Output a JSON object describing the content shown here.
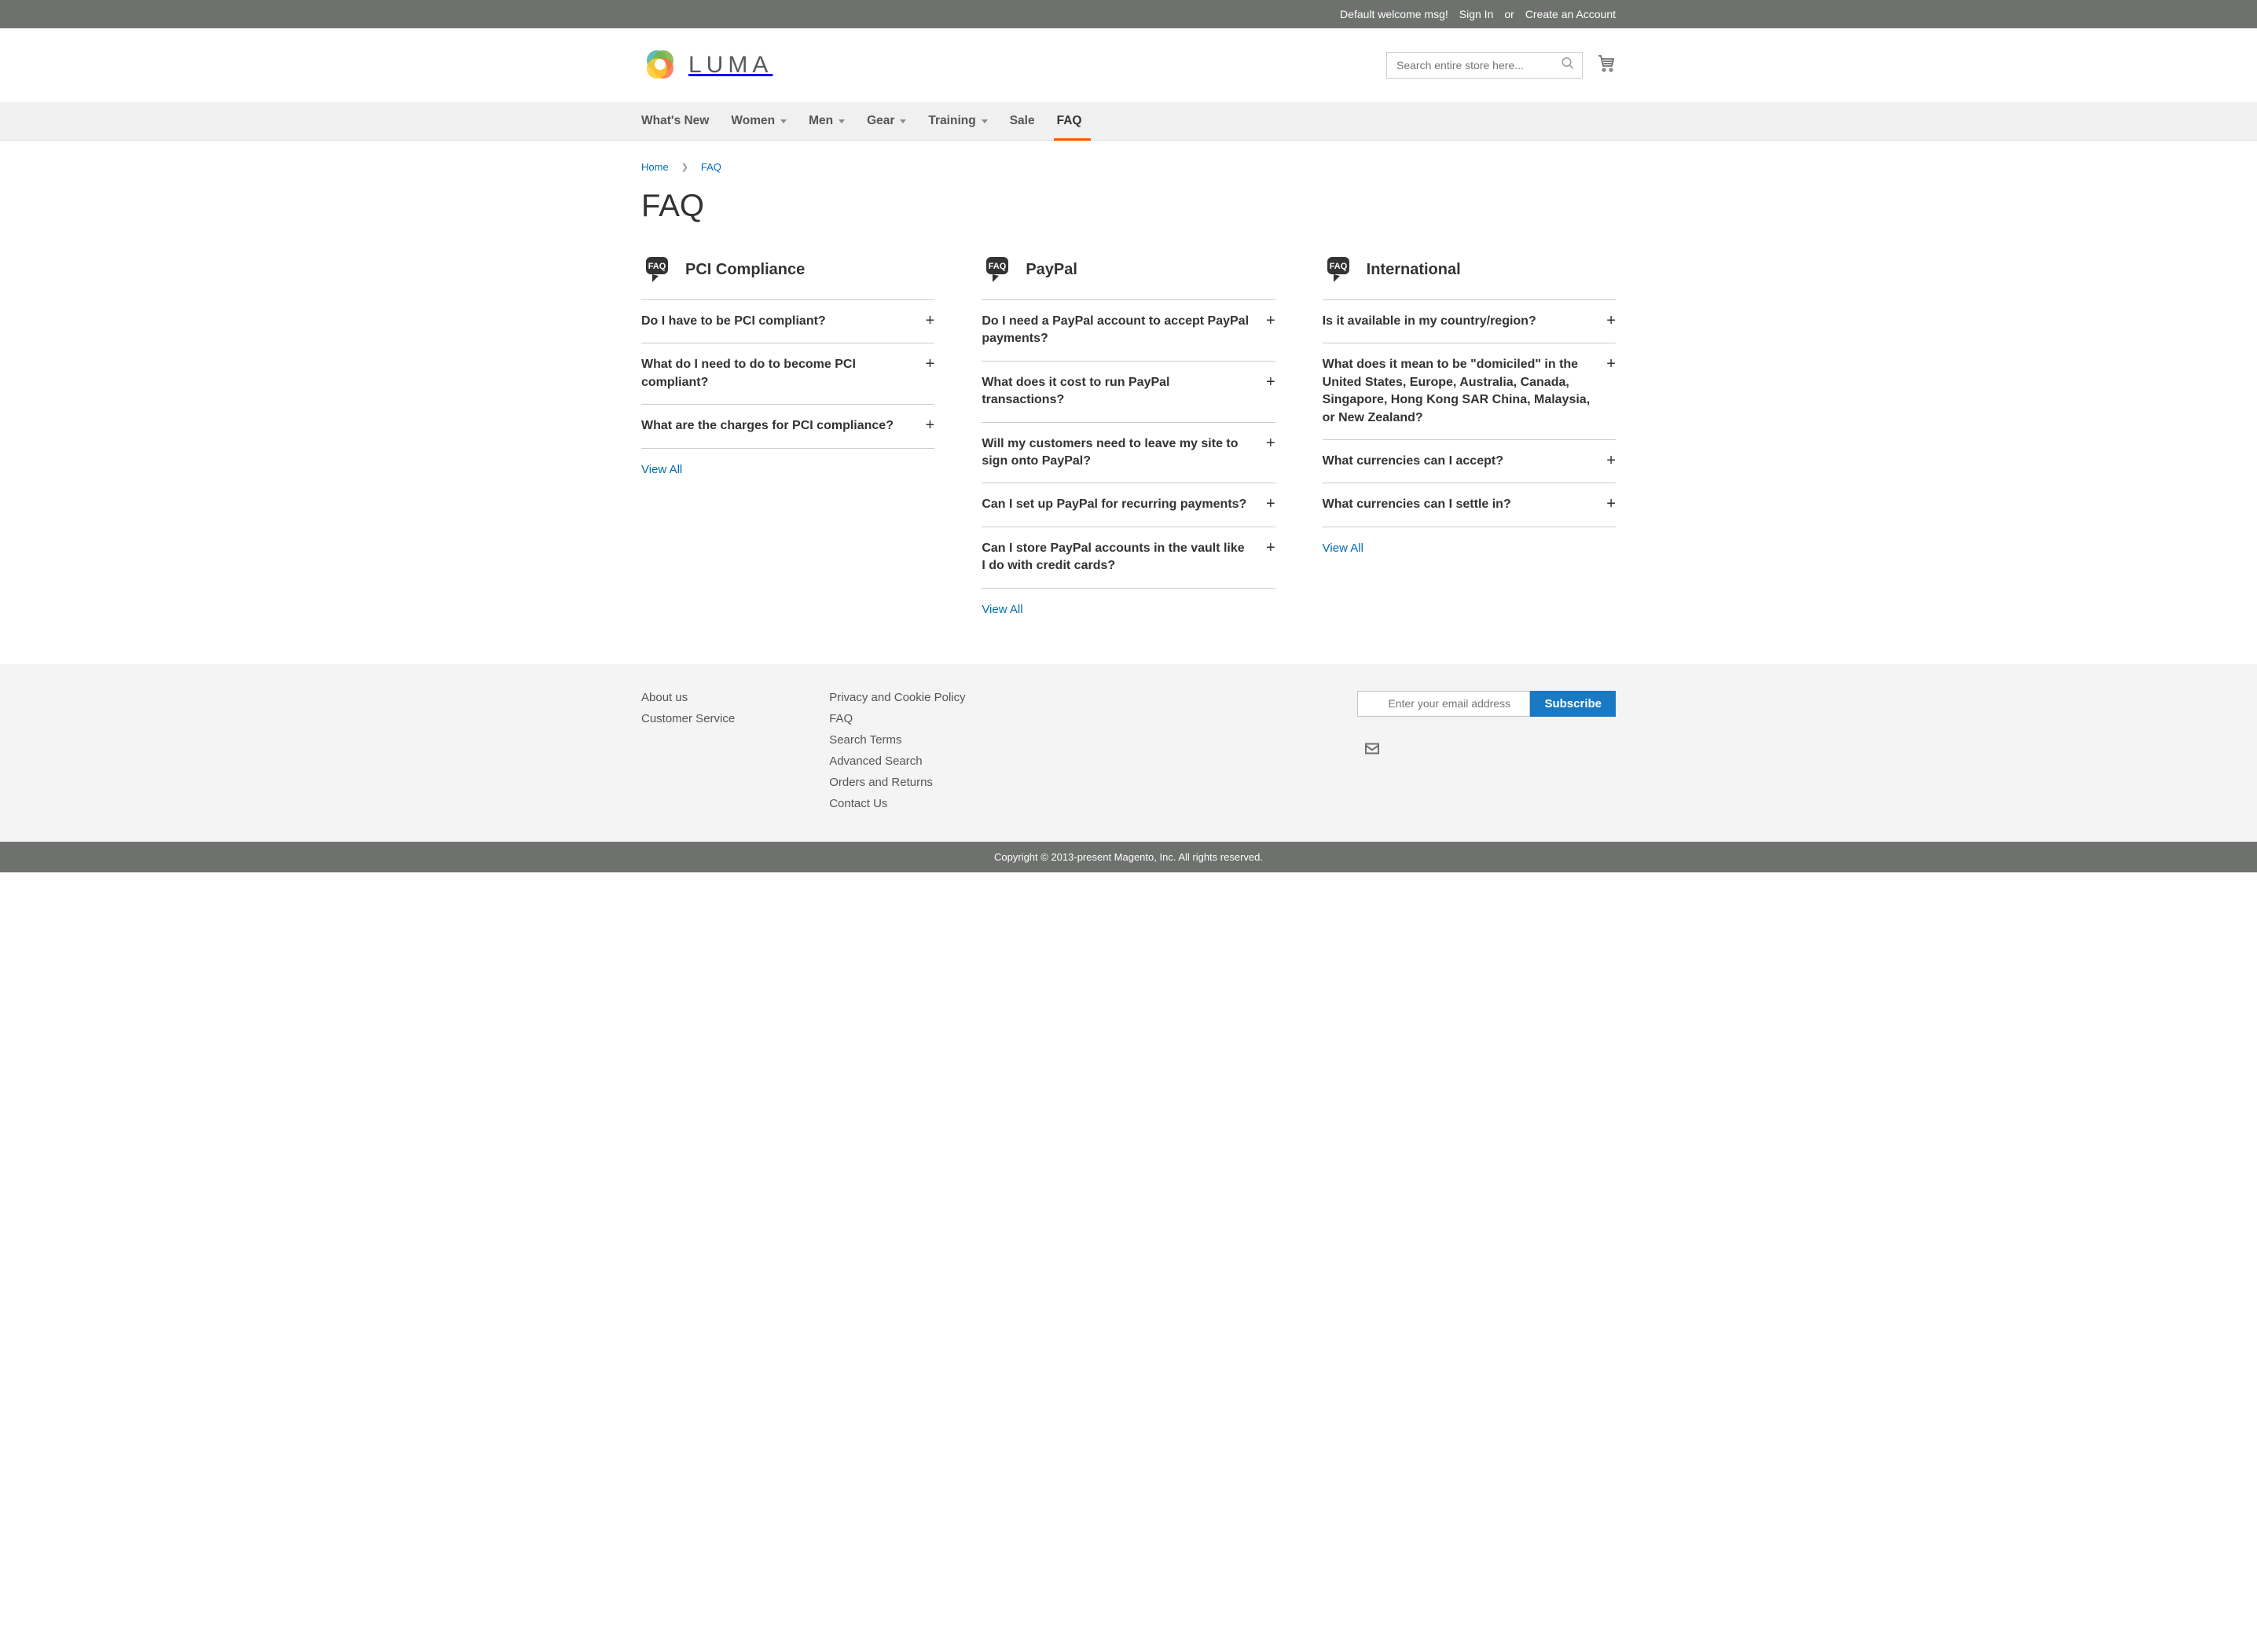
{
  "topbar": {
    "welcome": "Default welcome msg!",
    "signin": "Sign In",
    "or": "or",
    "create": "Create an Account"
  },
  "logo_text": "LUMA",
  "search": {
    "placeholder": "Search entire store here..."
  },
  "nav": {
    "whats_new": "What's New",
    "women": "Women",
    "men": "Men",
    "gear": "Gear",
    "training": "Training",
    "sale": "Sale",
    "faq": "FAQ"
  },
  "breadcrumb": {
    "home": "Home",
    "faq": "FAQ"
  },
  "page_title": "FAQ",
  "faq": {
    "col1": {
      "title": "PCI Compliance",
      "q1": "Do I have to be PCI compliant?",
      "q2": "What do I need to do to become PCI compliant?",
      "q3": "What are the charges for PCI compliance?",
      "view_all": "View All"
    },
    "col2": {
      "title": "PayPal",
      "q1": "Do I need a PayPal account to accept PayPal payments?",
      "q2": "What does it cost to run PayPal transactions?",
      "q3": "Will my customers need to leave my site to sign onto PayPal?",
      "q4": "Can I set up PayPal for recurring payments?",
      "q5": "Can I store PayPal accounts in the vault like I do with credit cards?",
      "view_all": "View All"
    },
    "col3": {
      "title": "International",
      "q1": "Is it available in my country/region?",
      "q2": "What does it mean to be \"domiciled\" in the United States, Europe, Australia, Canada, Singapore, Hong Kong SAR China, Malaysia, or New Zealand?",
      "q3": "What currencies can I accept?",
      "q4": "What currencies can I settle in?",
      "view_all": "View All"
    }
  },
  "footer": {
    "col1": {
      "about": "About us",
      "customer_service": "Customer Service"
    },
    "col2": {
      "privacy": "Privacy and Cookie Policy",
      "faq": "FAQ",
      "search_terms": "Search Terms",
      "advanced_search": "Advanced Search",
      "orders_returns": "Orders and Returns",
      "contact": "Contact Us"
    },
    "newsletter": {
      "placeholder": "Enter your email address",
      "button": "Subscribe"
    }
  },
  "copyright": "Copyright © 2013-present Magento, Inc. All rights reserved."
}
